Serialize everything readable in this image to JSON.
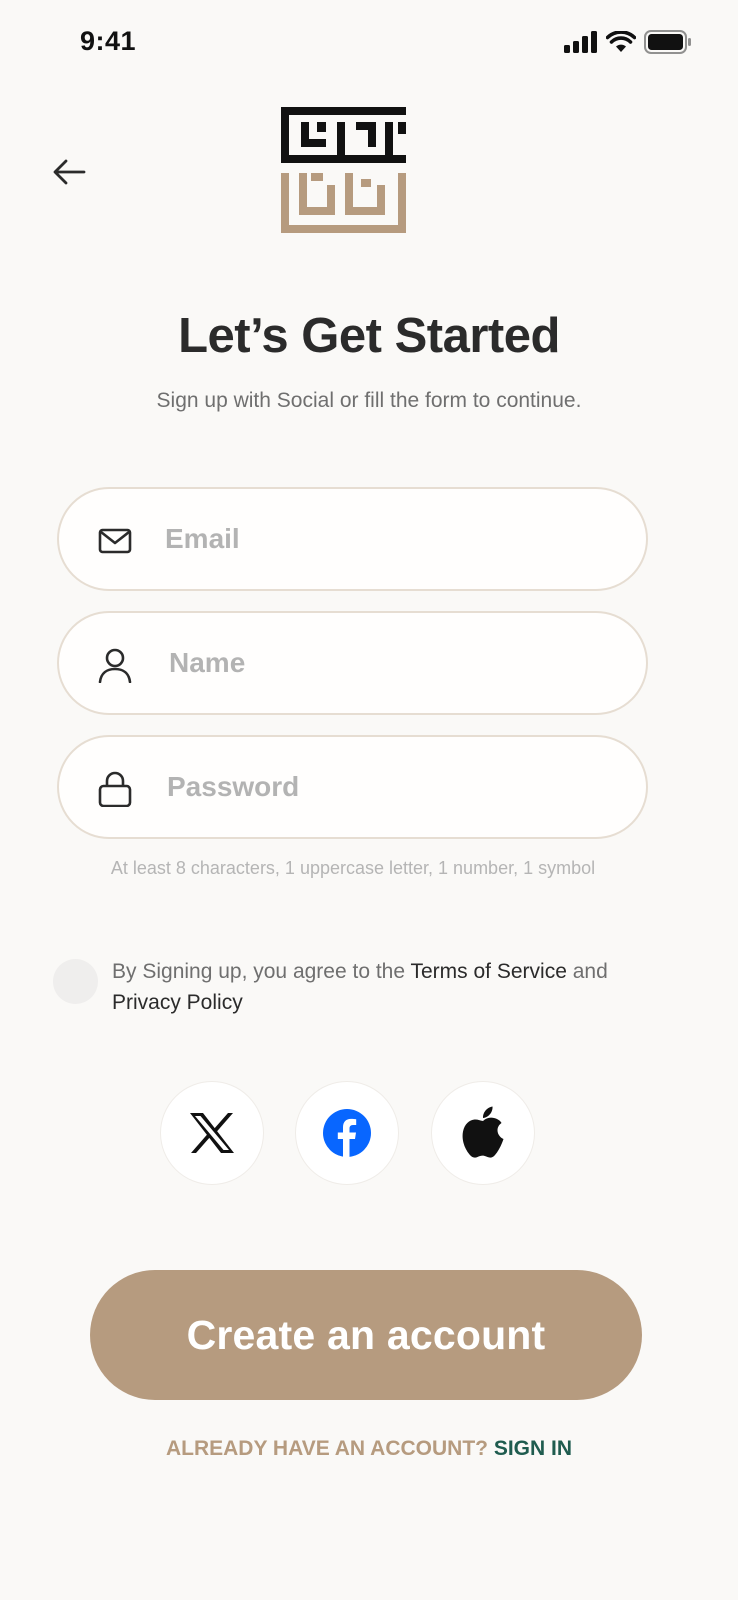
{
  "status_bar": {
    "time": "9:41"
  },
  "header": {
    "back_icon": "arrow-left-icon",
    "logo_icon": "kufic-logo"
  },
  "title": "Let’s Get Started",
  "subtitle": "Sign up with Social or fill the form to continue.",
  "form": {
    "email": {
      "placeholder": "Email",
      "value": "",
      "icon": "mail-icon"
    },
    "name": {
      "placeholder": "Name",
      "value": "",
      "icon": "user-icon"
    },
    "password": {
      "placeholder": "Password",
      "value": "",
      "icon": "lock-icon"
    },
    "password_hint": "At least 8 characters, 1 uppercase letter, 1 number, 1 symbol"
  },
  "agreement": {
    "prefix": "By Signing up, you agree to the ",
    "terms": "Terms of Service",
    "middle": " and ",
    "privacy": "Privacy Policy",
    "checked": false
  },
  "social": [
    {
      "name": "X",
      "icon": "x-icon"
    },
    {
      "name": "Facebook",
      "icon": "facebook-icon",
      "color": "#0866ff"
    },
    {
      "name": "Apple",
      "icon": "apple-icon"
    }
  ],
  "cta_label": "Create an account",
  "footer": {
    "question": "ALREADY HAVE AN ACCOUNT?",
    "signin": "SIGN IN"
  },
  "colors": {
    "brand_tan": "#b69b7f",
    "brand_green": "#1f5c4f",
    "background": "#faf9f7"
  }
}
